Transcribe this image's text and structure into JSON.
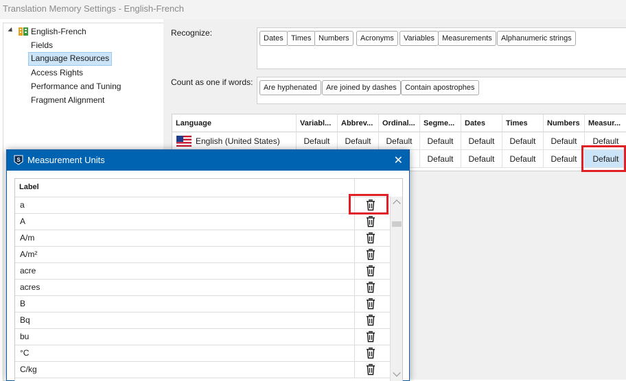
{
  "window": {
    "title": "Translation Memory Settings - English-French"
  },
  "tree": {
    "root": "English-French",
    "items": [
      "Fields",
      "Language Resources",
      "Access Rights",
      "Performance and Tuning",
      "Fragment Alignment"
    ],
    "selected": "Language Resources"
  },
  "recognize": {
    "label": "Recognize:",
    "chips": [
      "Dates",
      "Times",
      "Numbers",
      "Acronyms",
      "Variables",
      "Measurements",
      "Alphanumeric strings"
    ]
  },
  "count": {
    "label": "Count as one if words:",
    "chips": [
      "Are hyphenated",
      "Are joined by dashes",
      "Contain apostrophes"
    ]
  },
  "grid": {
    "headers": [
      "Language",
      "Variabl...",
      "Abbrev...",
      "Ordinal...",
      "Segme...",
      "Dates",
      "Times",
      "Numbers",
      "Measur..."
    ],
    "rows": [
      {
        "language": "English (United States)",
        "values": [
          "Default",
          "Default",
          "Default",
          "Default",
          "Default",
          "Default",
          "Default",
          "Default"
        ]
      },
      {
        "language": "",
        "values": [
          "",
          "",
          "lt",
          "Default",
          "Default",
          "Default",
          "Default",
          "Default"
        ]
      }
    ]
  },
  "dialog": {
    "title": "Measurement Units",
    "close": "✕",
    "column_label": "Label",
    "units": [
      "a",
      "A",
      "A/m",
      "A/m²",
      "acre",
      "acres",
      "B",
      "Bq",
      "bu",
      "°C",
      "C/kg"
    ]
  }
}
